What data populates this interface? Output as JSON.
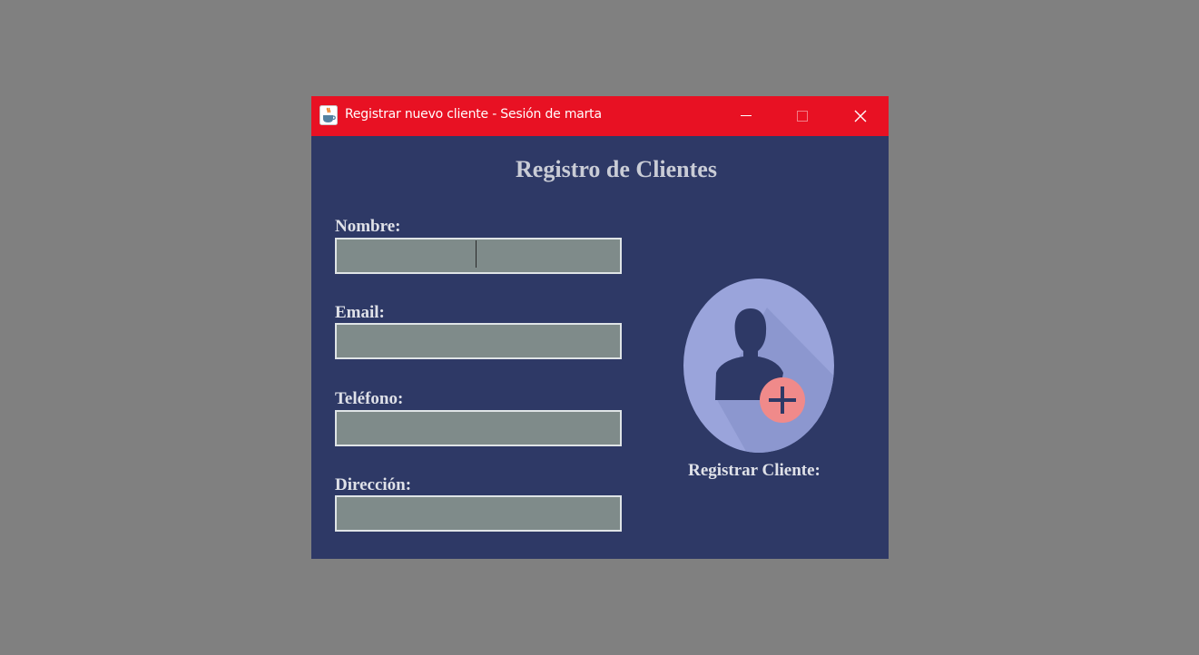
{
  "window": {
    "title": "Registrar nuevo cliente - Sesión de marta",
    "controls": {
      "minimize": "minimize",
      "maximize": "maximize",
      "close": "close"
    }
  },
  "form": {
    "heading": "Registro de Clientes",
    "fields": [
      {
        "label": "Nombre:",
        "value": ""
      },
      {
        "label": "Email:",
        "value": ""
      },
      {
        "label": "Teléfono:",
        "value": ""
      },
      {
        "label": "Dirección:",
        "value": ""
      }
    ],
    "register_button_label": "Registrar Cliente:"
  },
  "colors": {
    "titlebar": "#e81123",
    "window_bg": "#2e3966",
    "field_bg": "#7f8b8a",
    "avatar_circle": "#9aa4db",
    "avatar_silhouette": "#2e3966",
    "plus_badge": "#f08a8a"
  },
  "icons": {
    "app": "java-cup-icon",
    "avatar": "add-user-icon",
    "badge": "plus-icon"
  }
}
